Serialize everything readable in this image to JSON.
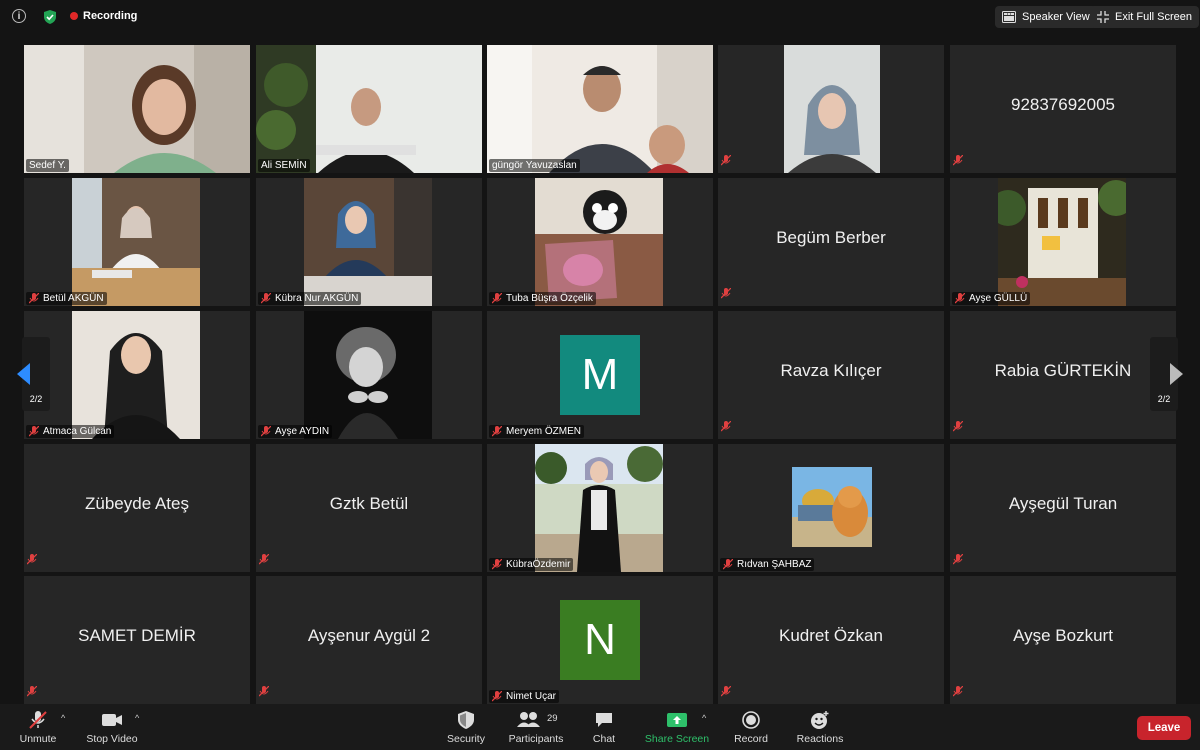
{
  "topbar": {
    "recording": "Recording",
    "speaker_view": "Speaker View",
    "exit_full_screen": "Exit Full Screen"
  },
  "pagination": {
    "left": "2/2",
    "right": "2/2"
  },
  "tiles": [
    {
      "name": "Sedef Y."
    },
    {
      "name": "Ali SEMİN"
    },
    {
      "name": "güngör Yavuzaslan"
    },
    {
      "name": ""
    },
    {
      "big": "92837692005"
    },
    {
      "name": "Betül AKGÜN"
    },
    {
      "name": "Kübra Nur AKGÜN"
    },
    {
      "name": "Tuba Büşra Özçelik"
    },
    {
      "big": "Begüm Berber"
    },
    {
      "name": "Ayşe GÜLLÜ"
    },
    {
      "name": "Atmaca Gülcan"
    },
    {
      "name": "Ayşe AYDIN"
    },
    {
      "name": "Meryem ÖZMEN",
      "avatar": "M"
    },
    {
      "big": "Ravza Kılıçer"
    },
    {
      "big": "Rabia GÜRTEKİN"
    },
    {
      "big": "Zübeyde Ateş"
    },
    {
      "big": "Gztk Betül"
    },
    {
      "name": "KübraÖzdemir"
    },
    {
      "name": "Rıdvan ŞAHBAZ"
    },
    {
      "big": "Ayşegül Turan"
    },
    {
      "big": "SAMET DEMİR"
    },
    {
      "big": "Ayşenur Aygül 2"
    },
    {
      "name": "Nimet Uçar",
      "avatar": "N"
    },
    {
      "big": "Kudret Özkan"
    },
    {
      "big": "Ayşe Bozkurt"
    }
  ],
  "toolbar": {
    "unmute": "Unmute",
    "stop_video": "Stop Video",
    "security": "Security",
    "participants": "Participants",
    "participants_count": "29",
    "chat": "Chat",
    "share_screen": "Share Screen",
    "record": "Record",
    "reactions": "Reactions",
    "leave": "Leave"
  },
  "colors": {
    "active_speaker_border": "#d5e88a",
    "avatar_m": "#128a7e",
    "avatar_n": "#3a7d22",
    "share_green": "#2ec06a",
    "leave_red": "#c8242c",
    "nav_arrow": "#2d8cff"
  }
}
